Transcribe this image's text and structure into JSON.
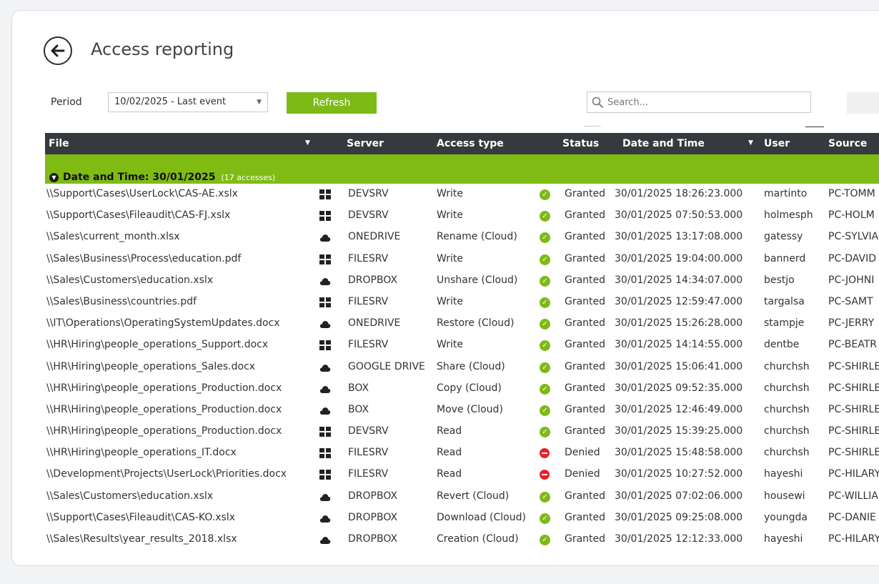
{
  "page": {
    "title": "Access reporting",
    "back_icon": "arrow-left-circle-icon"
  },
  "toolbar": {
    "period_label": "Period",
    "period_value": "10/02/2025 - Last event",
    "refresh_label": "Refresh",
    "search_placeholder": "Search..."
  },
  "colors": {
    "accent_green": "#7dba16",
    "group_green": "#80bb14",
    "header_dark": "#36393d",
    "denied_red": "#e8202a"
  },
  "table": {
    "columns": [
      "File",
      "Server",
      "Access type",
      "Status",
      "Date and Time",
      "User",
      "Source"
    ],
    "group": {
      "label": "Date and Time: 30/01/2025",
      "count": "(17 accesses)"
    },
    "rows": [
      {
        "file": "\\\\Support\\Cases\\UserLock\\CAS-AE.xslx",
        "server_icon": "windows-icon",
        "server": "DEVSRV",
        "access": "Write",
        "status_icon": "granted-icon",
        "status": "Granted",
        "date": "30/01/2025 18:26:23.000",
        "user": "martinto",
        "source": "PC-TOMM"
      },
      {
        "file": "\\\\Support\\Cases\\Fileaudit\\CAS-FJ.xslx",
        "server_icon": "windows-icon",
        "server": "DEVSRV",
        "access": "Write",
        "status_icon": "granted-icon",
        "status": "Granted",
        "date": "30/01/2025 07:50:53.000",
        "user": "holmesph",
        "source": "PC-HOLM"
      },
      {
        "file": "\\\\Sales\\current_month.xlsx",
        "server_icon": "cloud-icon",
        "server": "ONEDRIVE",
        "access": "Rename (Cloud)",
        "status_icon": "granted-icon",
        "status": "Granted",
        "date": "30/01/2025 13:17:08.000",
        "user": "gatessy",
        "source": "PC-SYLVIA"
      },
      {
        "file": "\\\\Sales\\Business\\Process\\education.pdf",
        "server_icon": "windows-icon",
        "server": "FILESRV",
        "access": "Write",
        "status_icon": "granted-icon",
        "status": "Granted",
        "date": "30/01/2025 19:04:00.000",
        "user": "bannerd",
        "source": "PC-DAVID"
      },
      {
        "file": "\\\\Sales\\Customers\\education.xslx",
        "server_icon": "cloud-icon",
        "server": "DROPBOX",
        "access": "Unshare (Cloud)",
        "status_icon": "granted-icon",
        "status": "Granted",
        "date": "30/01/2025 14:34:07.000",
        "user": "bestjo",
        "source": "PC-JOHNI"
      },
      {
        "file": "\\\\Sales\\Business\\countries.pdf",
        "server_icon": "windows-icon",
        "server": "FILESRV",
        "access": "Write",
        "status_icon": "granted-icon",
        "status": "Granted",
        "date": "30/01/2025 12:59:47.000",
        "user": "targalsa",
        "source": "PC-SAMT"
      },
      {
        "file": "\\\\IT\\Operations\\OperatingSystemUpdates.docx",
        "server_icon": "cloud-icon",
        "server": "ONEDRIVE",
        "access": "Restore (Cloud)",
        "status_icon": "granted-icon",
        "status": "Granted",
        "date": "30/01/2025 15:26:28.000",
        "user": "stampje",
        "source": "PC-JERRY"
      },
      {
        "file": "\\\\HR\\Hiring\\people_operations_Support.docx",
        "server_icon": "windows-icon",
        "server": "FILESRV",
        "access": "Write",
        "status_icon": "granted-icon",
        "status": "Granted",
        "date": "30/01/2025 14:14:55.000",
        "user": "dentbe",
        "source": "PC-BEATR"
      },
      {
        "file": "\\\\HR\\Hiring\\people_operations_Sales.docx",
        "server_icon": "cloud-icon",
        "server": "GOOGLE DRIVE",
        "access": "Share (Cloud)",
        "status_icon": "granted-icon",
        "status": "Granted",
        "date": "30/01/2025 15:06:41.000",
        "user": "churchsh",
        "source": "PC-SHIRLE"
      },
      {
        "file": "\\\\HR\\Hiring\\people_operations_Production.docx",
        "server_icon": "cloud-icon",
        "server": "BOX",
        "access": "Copy (Cloud)",
        "status_icon": "granted-icon",
        "status": "Granted",
        "date": "30/01/2025 09:52:35.000",
        "user": "churchsh",
        "source": "PC-SHIRLE"
      },
      {
        "file": "\\\\HR\\Hiring\\people_operations_Production.docx",
        "server_icon": "cloud-icon",
        "server": "BOX",
        "access": "Move (Cloud)",
        "status_icon": "granted-icon",
        "status": "Granted",
        "date": "30/01/2025 12:46:49.000",
        "user": "churchsh",
        "source": "PC-SHIRLE"
      },
      {
        "file": "\\\\HR\\Hiring\\people_operations_Production.docx",
        "server_icon": "windows-icon",
        "server": "DEVSRV",
        "access": "Read",
        "status_icon": "granted-icon",
        "status": "Granted",
        "date": "30/01/2025 15:39:25.000",
        "user": "churchsh",
        "source": "PC-SHIRLE"
      },
      {
        "file": "\\\\HR\\Hiring\\people_operations_IT.docx",
        "server_icon": "windows-icon",
        "server": "FILESRV",
        "access": "Read",
        "status_icon": "denied-icon",
        "status": "Denied",
        "date": "30/01/2025 15:48:58.000",
        "user": "churchsh",
        "source": "PC-SHIRLE"
      },
      {
        "file": "\\\\Development\\Projects\\UserLock\\Priorities.docx",
        "server_icon": "windows-icon",
        "server": "FILESRV",
        "access": "Read",
        "status_icon": "denied-icon",
        "status": "Denied",
        "date": "30/01/2025 10:27:52.000",
        "user": "hayeshi",
        "source": "PC-HILARY"
      },
      {
        "file": "\\\\Sales\\Customers\\education.xslx",
        "server_icon": "cloud-icon",
        "server": "DROPBOX",
        "access": "Revert  (Cloud)",
        "status_icon": "granted-icon",
        "status": "Granted",
        "date": "30/01/2025 07:02:06.000",
        "user": "housewi",
        "source": "PC-WILLIA"
      },
      {
        "file": "\\\\Support\\Cases\\Fileaudit\\CAS-KO.xslx",
        "server_icon": "cloud-icon",
        "server": "DROPBOX",
        "access": "Download (Cloud)",
        "status_icon": "granted-icon",
        "status": "Granted",
        "date": "30/01/2025 09:25:08.000",
        "user": "youngda",
        "source": "PC-DANIE"
      },
      {
        "file": "\\\\Sales\\Results\\year_results_2018.xlsx",
        "server_icon": "cloud-icon",
        "server": "DROPBOX",
        "access": "Creation (Cloud)",
        "status_icon": "granted-icon",
        "status": "Granted",
        "date": "30/01/2025 12:12:33.000",
        "user": "hayeshi",
        "source": "PC-HILARY"
      }
    ]
  }
}
